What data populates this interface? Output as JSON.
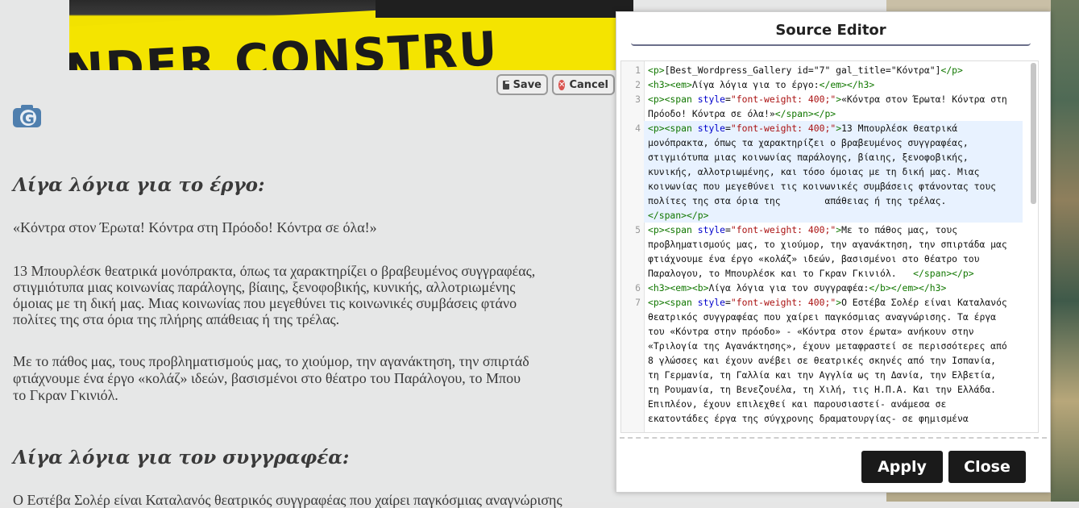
{
  "background_page": {
    "hero_text": "NDER CONSTRU",
    "save_label": "Save",
    "cancel_label": "Cancel",
    "heading1": "Λίγα λόγια για το έργο:",
    "quote": "«Κόντρα στον Έρωτα! Κόντρα στη Πρόοδο! Κόντρα σε όλα!»",
    "para1": [
      "13 Μπουρλέσκ θεατρικά μονόπρακτα, όπως τα χαρακτηρίζει ο βραβευμένος συγγραφέας,",
      "στιγμιότυπα μιας κοινωνίας παράλογης, βίαιης, ξενοφοβικής, κυνικής, αλλοτριωμένης",
      "όμοιας με τη δική μας. Μιας κοινωνίας που μεγεθύνει τις κοινωνικές συμβάσεις φτάνο",
      "πολίτες της στα όρια της πλήρης απάθειας ή της τρέλας."
    ],
    "para2": [
      "Με το πάθος μας, τους προβληματισμούς μας, το χιούμορ, την αγανάκτηση, την σπιρτάδ",
      "φτιάχνουμε ένα έργο «κολάζ» ιδεών, βασισμένοι στο θέατρο του Παράλογου, το Μπου",
      "το Γκραν Γκινιόλ."
    ],
    "heading2": "Λίγα λόγια για τον συγγραφέα:",
    "para3": "Ο Εστέβα Σολέρ είναι Καταλανός θεατρικός συγγραφέας που χαίρει παγκόσμιας αναγνώρισης"
  },
  "dialog": {
    "title": "Source Editor",
    "apply_label": "Apply",
    "close_label": "Close",
    "code_lines": [
      {
        "n": "1",
        "rows": [
          [
            [
              "tg",
              "<p>"
            ],
            [
              "tx",
              "[Best_Wordpress_Gallery id=\"7\" gal_title=\"Κόντρα\"]"
            ],
            [
              "tg",
              "</p>"
            ]
          ]
        ]
      },
      {
        "n": "2",
        "rows": [
          [
            [
              "tg",
              "<h3><em>"
            ],
            [
              "tx",
              "Λίγα λόγια για το έργο:"
            ],
            [
              "tg",
              "</em></h3>"
            ]
          ]
        ]
      },
      {
        "n": "3",
        "rows": [
          [
            [
              "tg",
              "<p><span "
            ],
            [
              "at",
              "style"
            ],
            [
              "tx",
              "="
            ],
            [
              "st",
              "\"font-weight: 400;\""
            ],
            [
              "tg",
              ">"
            ],
            [
              "tx",
              "«Κόντρα στον Έρωτα! Κόντρα στη"
            ]
          ],
          [
            [
              "tx",
              "Πρόοδο! Κόντρα σε όλα!»"
            ],
            [
              "tg",
              "</span></p>"
            ]
          ]
        ]
      },
      {
        "n": "4",
        "hl": true,
        "rows": [
          [
            [
              "tg",
              "<p><span "
            ],
            [
              "at",
              "style"
            ],
            [
              "tx",
              "="
            ],
            [
              "st",
              "\"font-weight: 400;\""
            ],
            [
              "tg",
              ">"
            ],
            [
              "tx",
              "13 Μπουρλέσκ θεατρικά"
            ]
          ],
          [
            [
              "tx",
              "μονόπρακτα, όπως τα χαρακτηρίζει ο βραβευμένος συγγραφέας,"
            ]
          ],
          [
            [
              "tx",
              "στιγμιότυπα μιας κοινωνίας παράλογης, βίαιης, ξενοφοβικής,"
            ]
          ],
          [
            [
              "tx",
              "κυνικής, αλλοτριωμένης, και τόσο όμοιας με τη δική μας. Μιας"
            ]
          ],
          [
            [
              "tx",
              "κοινωνίας που μεγεθύνει τις κοινωνικές συμβάσεις φτάνοντας τους"
            ]
          ],
          [
            [
              "tx",
              "πολίτες της στα όρια της        απάθειας ή της τρέλας."
            ]
          ],
          [
            [
              "tg",
              "</span></p>"
            ]
          ]
        ]
      },
      {
        "n": "5",
        "rows": [
          [
            [
              "tg",
              "<p><span "
            ],
            [
              "at",
              "style"
            ],
            [
              "tx",
              "="
            ],
            [
              "st",
              "\"font-weight: 400;\""
            ],
            [
              "tg",
              ">"
            ],
            [
              "tx",
              "Με το πάθος μας, τους"
            ]
          ],
          [
            [
              "tx",
              "προβληματισμούς μας, το χιούμορ, την αγανάκτηση, την σπιρτάδα μας"
            ]
          ],
          [
            [
              "tx",
              "φτιάχνουμε ένα έργο «κολάζ» ιδεών, βασισμένοι στο θέατρο του"
            ]
          ],
          [
            [
              "tx",
              "Παραλογου, το Μπουρλέσκ και το Γκραν Γκινιόλ.   "
            ],
            [
              "tg",
              "</span></p>"
            ]
          ]
        ]
      },
      {
        "n": "6",
        "rows": [
          [
            [
              "tg",
              "<h3><em><b>"
            ],
            [
              "tx",
              "Λίγα λόγια για τον συγγραφέα:"
            ],
            [
              "tg",
              "</b></em></h3>"
            ]
          ]
        ]
      },
      {
        "n": "7",
        "rows": [
          [
            [
              "tg",
              "<p><span "
            ],
            [
              "at",
              "style"
            ],
            [
              "tx",
              "="
            ],
            [
              "st",
              "\"font-weight: 400;\""
            ],
            [
              "tg",
              ">"
            ],
            [
              "tx",
              "Ο Εστέβα Σολέρ είναι Καταλανός"
            ]
          ],
          [
            [
              "tx",
              "θεατρικός συγγραφέας που χαίρει παγκόσμιας αναγνώρισης. Τα έργα"
            ]
          ],
          [
            [
              "tx",
              "του «Κόντρα στην πρόοδο» - «Κόντρα στον έρωτα» ανήκουν στην"
            ]
          ],
          [
            [
              "tx",
              "«Τριλογία της Αγανάκτησης», έχουν μεταφραστεί σε περισσότερες από"
            ]
          ],
          [
            [
              "tx",
              "8 γλώσσες και έχουν ανέβει σε θεατρικές σκηνές από την Ισπανία,"
            ]
          ],
          [
            [
              "tx",
              "τη Γερμανία, τη Γαλλία και την Αγγλία ως τη Δανία, την Ελβετία,"
            ]
          ],
          [
            [
              "tx",
              "τη Ρουμανία, τη Βενεζουέλα, τη Χιλή, τις Η.Π.Α. Και την Ελλάδα."
            ]
          ],
          [
            [
              "tx",
              "Επιπλέον, έχουν επιλεχθεί και παρουσιαστεί- ανάμεσα σε"
            ]
          ],
          [
            [
              "tx",
              "εκατοντάδες έργα της σύγχρονης δραματουργίας- σε φημισμένα"
            ]
          ]
        ]
      }
    ]
  }
}
